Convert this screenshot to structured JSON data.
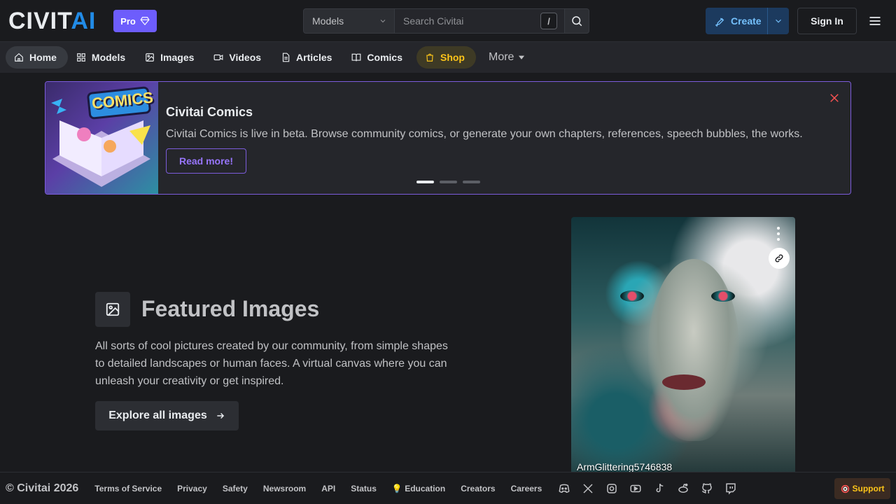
{
  "header": {
    "logo_left": "CIVIT",
    "logo_right": "AI",
    "pro_label": "Pro",
    "search_category": "Models",
    "search_placeholder": "Search Civitai",
    "search_shortcut": "/",
    "create_label": "Create",
    "signin_label": "Sign In"
  },
  "nav": {
    "items": [
      {
        "label": "Home"
      },
      {
        "label": "Models"
      },
      {
        "label": "Images"
      },
      {
        "label": "Videos"
      },
      {
        "label": "Articles"
      },
      {
        "label": "Comics"
      },
      {
        "label": "Shop"
      }
    ],
    "more_label": "More"
  },
  "banner": {
    "title": "Civitai Comics",
    "text": "Civitai Comics is live in beta. Browse community comics, or generate your own chapters, references, speech bubbles, the works.",
    "button_label": "Read more!",
    "slides_total": 3,
    "slide_active": 1,
    "image_text": "COMICS"
  },
  "featured": {
    "title": "Featured Images",
    "description": "All sorts of cool pictures created by our community, from simple shapes to detailed landscapes or human faces. A virtual canvas where you can unleash your creativity or get inspired.",
    "button_label": "Explore all images",
    "card_user": "ArmGlittering5746838"
  },
  "footer": {
    "copyright": "© Civitai 2026",
    "links": [
      "Terms of Service",
      "Privacy",
      "Safety",
      "Newsroom",
      "API",
      "Status",
      "💡 Education",
      "Creators",
      "Careers"
    ],
    "socials": [
      "discord-icon",
      "x-icon",
      "instagram-icon",
      "youtube-icon",
      "tiktok-icon",
      "reddit-icon",
      "github-icon",
      "twitch-icon"
    ],
    "support_label": "Support"
  },
  "colors": {
    "background": "#1a1b1e",
    "accent_blue": "#228be6",
    "pro_purple": "#6d5dfc",
    "banner_border": "#7c5cdb",
    "shop_yellow": "#fcc419"
  }
}
